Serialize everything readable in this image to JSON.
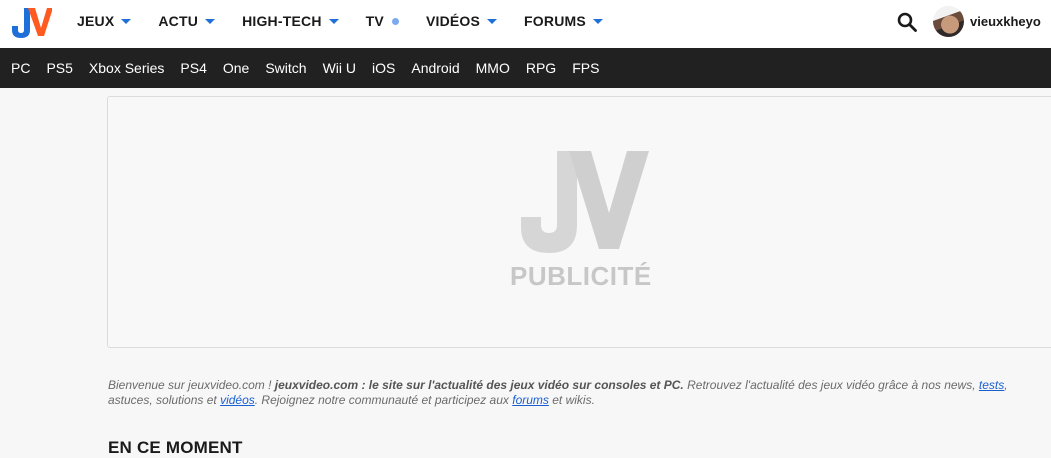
{
  "brand": {
    "logo_text": "JV"
  },
  "nav": {
    "items": [
      {
        "label": "JEUX",
        "marker": "caret"
      },
      {
        "label": "ACTU",
        "marker": "caret"
      },
      {
        "label": "HIGH-TECH",
        "marker": "caret"
      },
      {
        "label": "TV",
        "marker": "dot"
      },
      {
        "label": "VIDÉOS",
        "marker": "caret"
      },
      {
        "label": "FORUMS",
        "marker": "caret"
      }
    ]
  },
  "header": {
    "search_icon": "search-icon",
    "username": "vieuxkheyo"
  },
  "subnav": {
    "items": [
      "PC",
      "PS5",
      "Xbox Series",
      "PS4",
      "One",
      "Switch",
      "Wii U",
      "iOS",
      "Android",
      "MMO",
      "RPG",
      "FPS"
    ]
  },
  "ad": {
    "logo_text": "JV",
    "label": "PUBLICITÉ"
  },
  "welcome": {
    "intro": "Bienvenue sur jeuxvideo.com ! ",
    "bold": "jeuxvideo.com : le site sur l'actualité des jeux vidéo sur consoles et PC.",
    "part2": " Retrouvez l'actualité des jeux vidéo grâce à nos news, ",
    "link_tests": "tests",
    "part3": ", astuces, solutions et ",
    "link_videos": "vidéos",
    "part4": ". Rejoignez notre communauté et participez aux ",
    "link_forums": "forums",
    "part5": " et wikis."
  },
  "section": {
    "title": "EN CE MOMENT"
  },
  "colors": {
    "accent_blue": "#1f6fd8",
    "accent_orange": "#ff5a1f",
    "subnav_bg": "#212121"
  }
}
